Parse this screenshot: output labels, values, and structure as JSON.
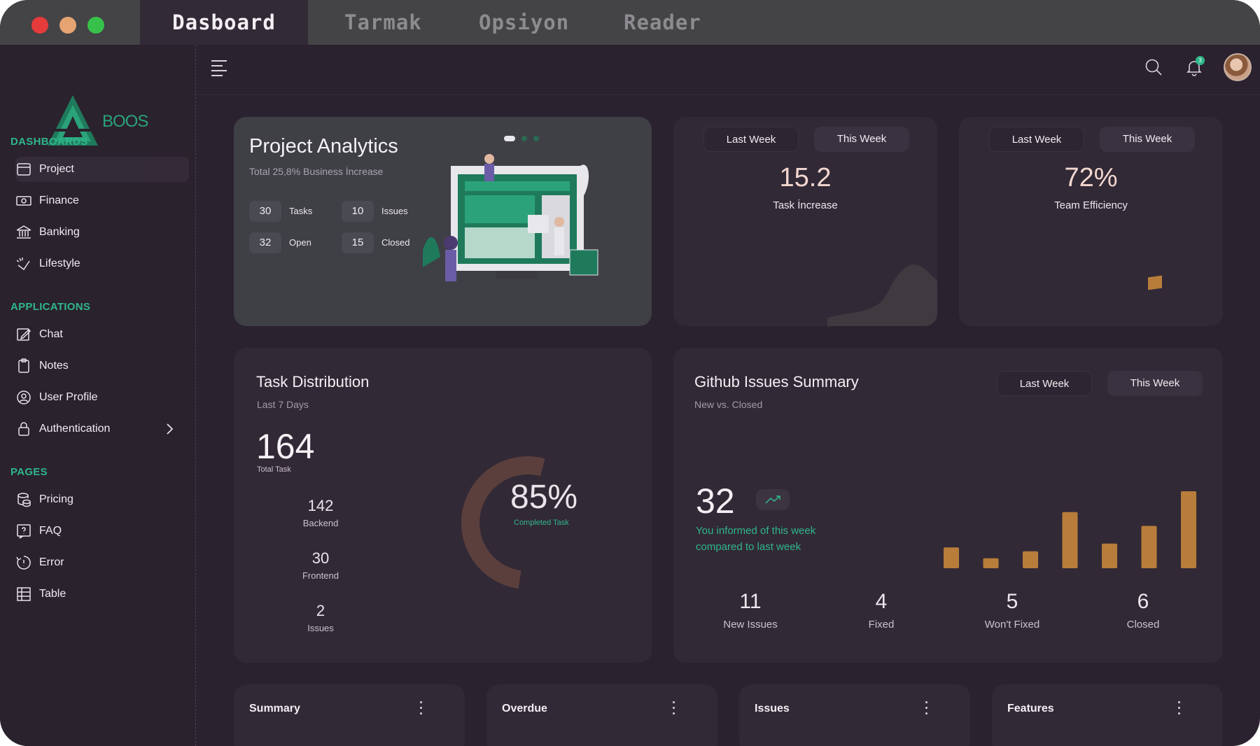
{
  "window": {
    "tabs": [
      {
        "label": "Dasboard"
      },
      {
        "label": "Tarmak"
      },
      {
        "label": "Opsiyon"
      },
      {
        "label": "Reader"
      }
    ]
  },
  "brand": {
    "logo_text": "BOOS",
    "accent": "#2fb68a"
  },
  "sidebar": {
    "sections": [
      {
        "title": "DASHBOARDS",
        "items": [
          {
            "label": "Project",
            "icon": "project-icon"
          },
          {
            "label": "Finance",
            "icon": "finance-icon"
          },
          {
            "label": "Banking",
            "icon": "bank-icon"
          },
          {
            "label": "Lifestyle",
            "icon": "lifestyle-icon"
          }
        ]
      },
      {
        "title": "APPLICATIONS",
        "items": [
          {
            "label": "Chat",
            "icon": "chat-icon"
          },
          {
            "label": "Notes",
            "icon": "notes-icon"
          },
          {
            "label": "User Profile",
            "icon": "user-icon"
          },
          {
            "label": "Authentication",
            "icon": "lock-icon"
          }
        ]
      },
      {
        "title": "PAGES",
        "items": [
          {
            "label": "Pricing",
            "icon": "pricing-icon"
          },
          {
            "label": "FAQ",
            "icon": "faq-icon"
          },
          {
            "label": "Error",
            "icon": "error-icon"
          },
          {
            "label": "Table",
            "icon": "table-icon"
          }
        ]
      }
    ]
  },
  "header": {
    "notification_count": "3"
  },
  "project_analytics": {
    "title": "Project Analytics",
    "subtitle": "Total 25,8% Business İncrease",
    "stats": [
      {
        "value": "30",
        "label": "Tasks"
      },
      {
        "value": "10",
        "label": "Issues"
      },
      {
        "value": "32",
        "label": "Open"
      },
      {
        "value": "15",
        "label": "Closed"
      }
    ]
  },
  "task_increase": {
    "last_week": "Last Week",
    "this_week": "This Week",
    "value": "15.2",
    "label": "Task İncrease"
  },
  "team_efficiency": {
    "last_week": "Last Week",
    "this_week": "This Week",
    "value": "72%",
    "label": "Team Efficiency",
    "level": 0.72
  },
  "task_distribution": {
    "title": "Task Distribution",
    "subtitle": "Last 7 Days",
    "total": "164",
    "total_label": "Total Task",
    "stats": [
      {
        "value": "142",
        "label": "Backend"
      },
      {
        "value": "30",
        "label": "Frontend"
      },
      {
        "value": "2",
        "label": "Issues"
      }
    ],
    "completed_pct": "85%",
    "completed_label": "Completed Task",
    "completed_fraction": 0.85
  },
  "github_issues": {
    "title": "Github Issues Summary",
    "subtitle": "New vs. Closed",
    "last_week": "Last Week",
    "this_week": "This Week",
    "value": "32",
    "message": "You informed of this week compared to last week",
    "bars": [
      0.27,
      0.13,
      0.22,
      0.73,
      0.32,
      0.55,
      1.0
    ],
    "bar_color": "#b87d3b",
    "stats": [
      {
        "value": "11",
        "label": "New Issues"
      },
      {
        "value": "4",
        "label": "Fixed"
      },
      {
        "value": "5",
        "label": "Won't Fixed"
      },
      {
        "value": "6",
        "label": "Closed"
      }
    ]
  },
  "bottom_cards": [
    {
      "title": "Summary"
    },
    {
      "title": "Overdue"
    },
    {
      "title": "Issues"
    },
    {
      "title": "Features"
    }
  ]
}
